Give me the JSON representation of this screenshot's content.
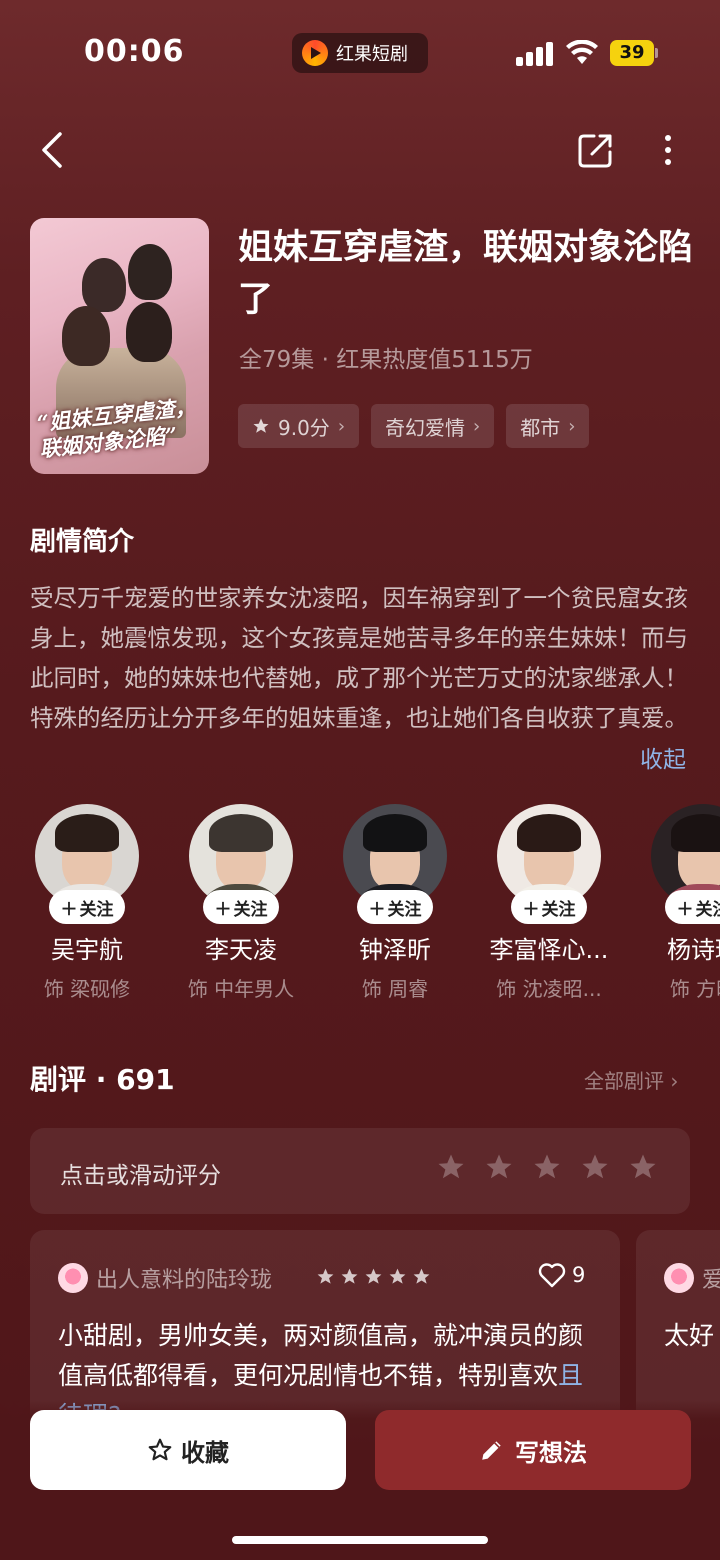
{
  "status": {
    "time": "00:06",
    "app_name": "红果短剧",
    "battery": "39"
  },
  "drama": {
    "title": "姐妹互穿虐渣，联姻对象沦陷了",
    "meta": "全79集 · 红果热度值5115万",
    "poster_title": "“姐妹互穿虐渣，联姻对象沦陷”",
    "tags": [
      {
        "label": "9.0分",
        "icon": "star-icon"
      },
      {
        "label": "奇幻爱情"
      },
      {
        "label": "都市"
      }
    ]
  },
  "synopsis": {
    "heading": "剧情简介",
    "text": "受尽万千宠爱的世家养女沈凌昭，因车祸穿到了一个贫民窟女孩身上，她震惊发现，这个女孩竟是她苦寻多年的亲生妹妹！而与此同时，她的妹妹也代替她，成了那个光芒万丈的沈家继承人！特殊的经历让分开多年的姐妹重逢，也让她们各自收获了真爱。",
    "collapse_label": "收起"
  },
  "cast": [
    {
      "name": "吴宇航",
      "role": "饰 梁砚修",
      "follow": "关注",
      "hair": "#2a1d18",
      "shirt": "#e9e6e2",
      "bg": "#d9d6d2"
    },
    {
      "name": "李天凌",
      "role": "饰 中年男人",
      "follow": "关注",
      "hair": "#3c3530",
      "shirt": "#4d4a3e",
      "bg": "#e4e2dc"
    },
    {
      "name": "钟泽昕",
      "role": "饰 周睿",
      "follow": "关注",
      "hair": "#121214",
      "shirt": "#1d1d22",
      "bg": "#4a4a50"
    },
    {
      "name": "李富怿心...",
      "role": "饰 沈凌昭...",
      "follow": "关注",
      "hair": "#2a1a16",
      "shirt": "#f2efe8",
      "bg": "#efe9e4"
    },
    {
      "name": "杨诗琪",
      "role": "饰 方时",
      "follow": "关注",
      "hair": "#1a1212",
      "shirt": "#a04a5a",
      "bg": "#2a2224"
    }
  ],
  "reviews": {
    "heading": "剧评 · 691",
    "all_label": "全部剧评",
    "rate_prompt": "点击或滑动评分",
    "items": [
      {
        "user": "出人意料的陆玲珑",
        "stars": 5,
        "likes": "9",
        "text": "小甜剧，男帅女美，两对颜值高，就冲演员的颜值高低都得看，更何况剧情也不错，特别喜欢",
        "more": "且待理?"
      },
      {
        "user": "爱",
        "text": "太好"
      }
    ]
  },
  "actions": {
    "collect_label": "收藏",
    "write_label": "写想法"
  },
  "colors": {
    "accent_link": "#8fb3e6",
    "primary_button": "#8f2a2c",
    "background": "#561a1d"
  }
}
